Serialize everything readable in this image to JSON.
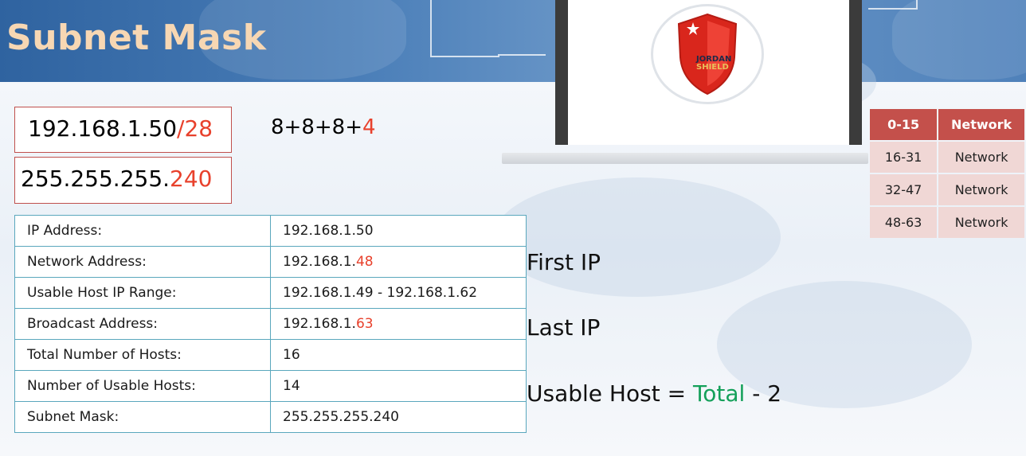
{
  "header": {
    "title": "Subnet Mask"
  },
  "logo": {
    "line1": "JORDAN",
    "line2": "SHIELD"
  },
  "ip_box": {
    "ip": "192.168.1.50",
    "cidr": "/28"
  },
  "mask_box": {
    "prefix": "255.255.255.",
    "last": "240"
  },
  "equation": {
    "prefix": "8+8+8+",
    "last": "4"
  },
  "info_table": {
    "rows": [
      {
        "key": "IP Address:",
        "value_main": "192.168.1.50",
        "value_red": ""
      },
      {
        "key": "Network Address:",
        "value_main": "192.168.1.",
        "value_red": "48"
      },
      {
        "key": "Usable Host IP Range:",
        "value_main": "192.168.1.49 - 192.168.1.62",
        "value_red": ""
      },
      {
        "key": "Broadcast Address:",
        "value_main": "192.168.1.",
        "value_red": "63"
      },
      {
        "key": "Total Number of Hosts:",
        "value_main": "16",
        "value_red": ""
      },
      {
        "key": "Number of Usable Hosts:",
        "value_main": "14",
        "value_red": ""
      },
      {
        "key": "Subnet Mask:",
        "value_main": "255.255.255.240",
        "value_red": ""
      }
    ]
  },
  "notes": {
    "first_ip": "First IP",
    "last_ip": "Last IP",
    "usable_prefix": "Usable Host = ",
    "usable_total": "Total",
    "usable_suffix": " - 2"
  },
  "ranges_table": {
    "header": {
      "range": "0-15",
      "type": "Network"
    },
    "rows": [
      {
        "range": "16-31",
        "type": "Network"
      },
      {
        "range": "32-47",
        "type": "Network"
      },
      {
        "range": "48-63",
        "type": "Network"
      }
    ]
  },
  "colors": {
    "accent_red": "#e8412c",
    "accent_green": "#14a05a",
    "table_border": "#5aa7bd",
    "range_header": "#c4504b",
    "range_row": "#f0d7d5",
    "title": "#f7d7b3"
  }
}
